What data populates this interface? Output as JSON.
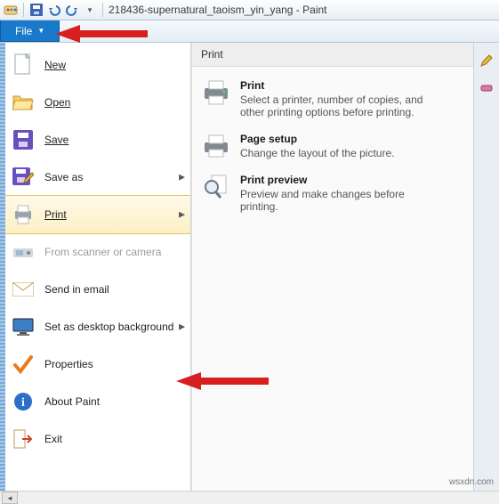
{
  "window": {
    "title": "218436-supernatural_taoism_yin_yang - Paint"
  },
  "ribbon": {
    "file_label": "File"
  },
  "menu": {
    "new": "New",
    "open": "Open",
    "save": "Save",
    "save_as": "Save as",
    "print": "Print",
    "scanner": "From scanner or camera",
    "send_email": "Send in email",
    "set_bg": "Set as desktop background",
    "properties": "Properties",
    "about": "About Paint",
    "exit": "Exit"
  },
  "panel": {
    "header": "Print",
    "items": [
      {
        "title": "Print",
        "desc": "Select a printer, number of copies, and other printing options before printing."
      },
      {
        "title": "Page setup",
        "desc": "Change the layout of the picture."
      },
      {
        "title": "Print preview",
        "desc": "Preview and make changes before printing."
      }
    ]
  },
  "watermark": "wsxdn.com"
}
